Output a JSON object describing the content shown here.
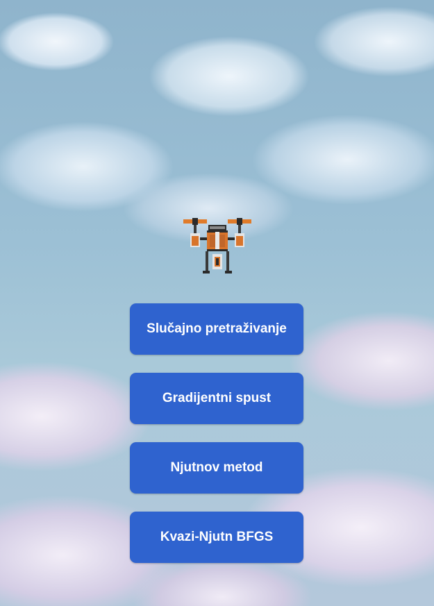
{
  "menu": {
    "buttons": [
      {
        "label": "Slučajno pretraživanje"
      },
      {
        "label": "Gradijentni spust"
      },
      {
        "label": "Njutnov metod"
      },
      {
        "label": "Kvazi-Njutn BFGS"
      }
    ]
  },
  "colors": {
    "button_bg": "#2f63cf",
    "button_text": "#ffffff",
    "drone_body": "#d8742b"
  },
  "icons": {
    "drone": "drone-icon"
  }
}
